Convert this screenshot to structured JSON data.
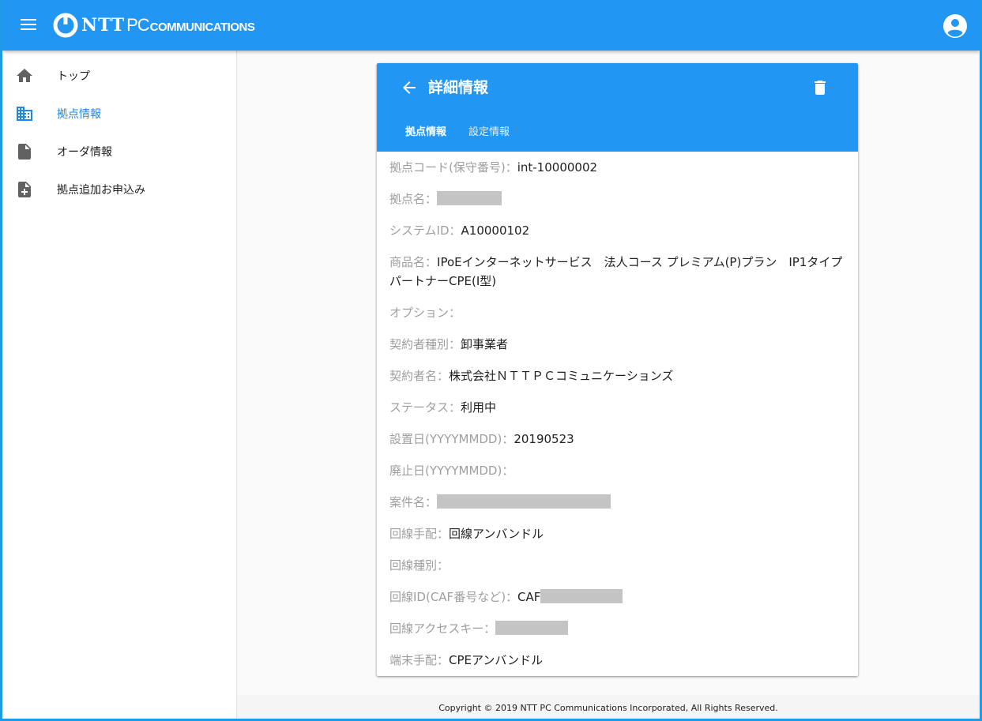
{
  "header": {
    "logo_ntt": "NTT",
    "logo_pc": "PC",
    "logo_comm": "COMMUNICATIONS",
    "menu_icon": "menu-icon",
    "account_icon": "account-circle-icon"
  },
  "sidebar": {
    "items": [
      {
        "label": "トップ",
        "icon": "home-icon"
      },
      {
        "label": "拠点情報",
        "icon": "building-icon",
        "active": true
      },
      {
        "label": "オーダ情報",
        "icon": "document-icon"
      },
      {
        "label": "拠点追加お申込み",
        "icon": "document-add-icon"
      }
    ]
  },
  "card": {
    "title": "詳細情報",
    "back_icon": "arrow-back-icon",
    "delete_icon": "trash-icon",
    "tabs": [
      {
        "label": "拠点情報",
        "active": true
      },
      {
        "label": "設定情報",
        "active": false
      }
    ],
    "fields": [
      {
        "label": "拠点コード(保守番号)：",
        "value": "int-10000002"
      },
      {
        "label": "拠点名：",
        "value": ""
      },
      {
        "label": "システムID：",
        "value": "A10000102"
      },
      {
        "label": "商品名：",
        "value": "IPoEインターネットサービス　法人コース プレミアム(P)プラン　IP1タイプ パートナーCPE(Ⅰ型)"
      },
      {
        "label": "オプション：",
        "value": ""
      },
      {
        "label": "契約者種別：",
        "value": "卸事業者"
      },
      {
        "label": "契約者名：",
        "value": "株式会社ＮＴＴＰＣコミュニケーションズ"
      },
      {
        "label": "ステータス：",
        "value": "利用中"
      },
      {
        "label": "設置日(YYYYMMDD)：",
        "value": "20190523"
      },
      {
        "label": "廃止日(YYYYMMDD)：",
        "value": ""
      },
      {
        "label": "案件名：",
        "value": ""
      },
      {
        "label": "回線手配：",
        "value": "回線アンバンドル"
      },
      {
        "label": "回線種別：",
        "value": ""
      },
      {
        "label": "回線ID(CAF番号など)：",
        "value": "CAF"
      },
      {
        "label": "回線アクセスキー：",
        "value": ""
      },
      {
        "label": "端末手配：",
        "value": "CPEアンバンドル"
      }
    ]
  },
  "footer": {
    "copyright": "Copyright © 2019 NTT PC Communications Incorporated, All Rights Reserved."
  },
  "colors": {
    "primary": "#2196f3",
    "active_nav": "#1e88e5",
    "label_grey": "#9e9e9e",
    "redaction": "#c4c4c4"
  }
}
